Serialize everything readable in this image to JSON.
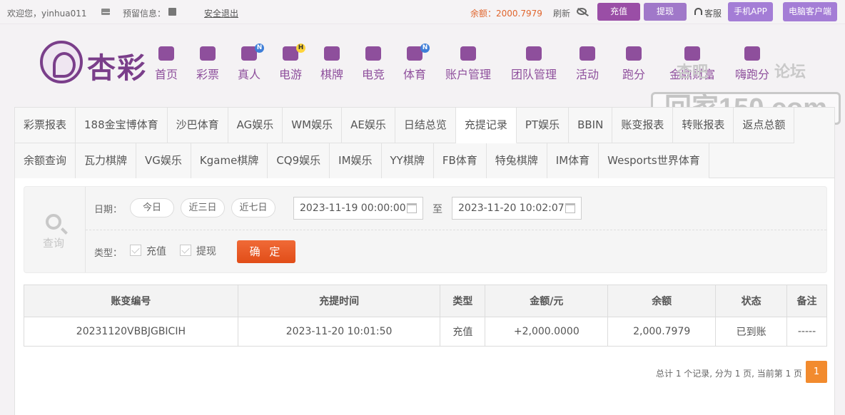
{
  "topbar": {
    "welcome": "欢迎您，yinhua011",
    "reserved_info": "预留信息：",
    "logout": "安全退出",
    "balance": "余额：2000.7979",
    "refresh": "刷新",
    "recharge": "充值",
    "withdraw": "提现",
    "service": "客服",
    "mobile_app": "手机APP",
    "pc_client": "电脑客户端"
  },
  "logo": {
    "text": "杏彩"
  },
  "nav": [
    {
      "label": "首页",
      "icon": "home-icon",
      "badge": ""
    },
    {
      "label": "彩票",
      "icon": "lottery-icon",
      "badge": ""
    },
    {
      "label": "真人",
      "icon": "dealer-icon",
      "badge": "N"
    },
    {
      "label": "电游",
      "icon": "gamepad-icon",
      "badge": "H"
    },
    {
      "label": "棋牌",
      "icon": "cards-icon",
      "badge": ""
    },
    {
      "label": "电竞",
      "icon": "controller-icon",
      "badge": ""
    },
    {
      "label": "体育",
      "icon": "trophy-icon",
      "badge": "N"
    },
    {
      "label": "账户管理",
      "icon": "yen-icon",
      "badge": ""
    },
    {
      "label": "团队管理",
      "icon": "team-icon",
      "badge": ""
    },
    {
      "label": "活动",
      "icon": "gift-icon",
      "badge": ""
    },
    {
      "label": "跑分",
      "icon": "run-icon",
      "badge": ""
    },
    {
      "label": "金鼎财富",
      "icon": "wealth-icon",
      "badge": ""
    },
    {
      "label": "嗨跑分",
      "icon": "hi-icon",
      "badge": ""
    }
  ],
  "watermark": {
    "line1": "杏吧",
    "line2": "论坛",
    "line3": "回家150.com"
  },
  "tabs_row1": [
    "彩票报表",
    "188金宝博体育",
    "沙巴体育",
    "AG娱乐",
    "WM娱乐",
    "AE娱乐",
    "日结总览",
    "充提记录",
    "PT娱乐",
    "BBIN",
    "账变报表",
    "转账报表",
    "返点总额"
  ],
  "tabs_row2": [
    "余额查询",
    "瓦力棋牌",
    "VG娱乐",
    "Kgame棋牌",
    "CQ9娱乐",
    "IM娱乐",
    "YY棋牌",
    "FB体育",
    "特兔棋牌",
    "IM体育",
    "Wesports世界体育"
  ],
  "active_tab": "充提记录",
  "filter": {
    "query_label": "查询",
    "date_label": "日期：",
    "today": "今日",
    "last3": "近三日",
    "last7": "近七日",
    "start": "2023-11-19 00:00:00",
    "to": "至",
    "end": "2023-11-20 10:02:07",
    "type_label": "类型：",
    "type_recharge": "充值",
    "type_withdraw": "提现",
    "confirm": "确 定"
  },
  "table": {
    "headers": [
      "账变编号",
      "充提时间",
      "类型",
      "金额/元",
      "余额",
      "状态",
      "备注"
    ],
    "rows": [
      [
        "20231120VBBJGBICIH",
        "2023-11-20 10:01:50",
        "充值",
        "+2,000.0000",
        "2,000.7979",
        "已到账",
        "-----"
      ]
    ]
  },
  "pagination": {
    "info": "总计 1 个记录, 分为 1 页, 当前第 1 页",
    "page": "1"
  },
  "colors": {
    "brand": "#8e4f9c",
    "accent": "#f28b2e",
    "amount": "#d6282c",
    "success": "#3ea235"
  }
}
